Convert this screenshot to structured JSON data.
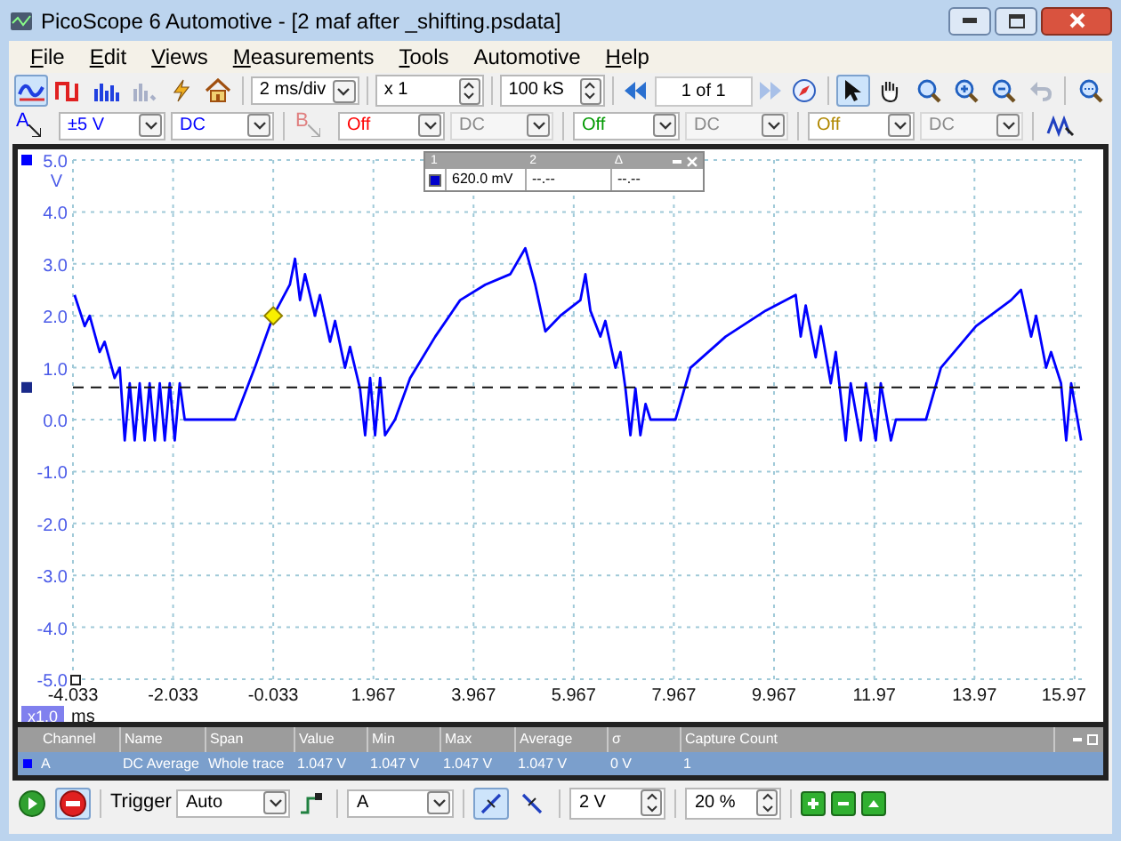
{
  "window": {
    "title": "PicoScope 6 Automotive - [2 maf after _shifting.psdata]"
  },
  "menu": [
    {
      "label": "File",
      "accelerator": true
    },
    {
      "label": "Edit",
      "accelerator": true
    },
    {
      "label": "Views",
      "accelerator": true
    },
    {
      "label": "Measurements",
      "accelerator": true
    },
    {
      "label": "Tools",
      "accelerator": true
    },
    {
      "label": "Automotive",
      "accelerator": false
    },
    {
      "label": "Help",
      "accelerator": true
    }
  ],
  "toolbar": {
    "modes": [
      {
        "kind": "scope",
        "selected": true
      },
      {
        "kind": "persistence",
        "selected": false
      },
      {
        "kind": "spectrum",
        "selected": false
      }
    ],
    "timebase": "2 ms/div",
    "zoom": "x 1",
    "samples": "100 kS",
    "buffer": "1 of 1",
    "tools": [
      {
        "kind": "pointer",
        "selected": true
      },
      {
        "kind": "hand",
        "selected": false
      },
      {
        "kind": "zoom-area",
        "selected": false
      },
      {
        "kind": "zoom-in",
        "selected": false
      },
      {
        "kind": "zoom-out",
        "selected": false
      },
      {
        "kind": "undo",
        "selected": false
      }
    ]
  },
  "channels": [
    {
      "name": "A",
      "range": "±5 V",
      "coupling": "DC",
      "color": "#0000ff",
      "enabled": true
    },
    {
      "name": "B",
      "range": "Off",
      "coupling": "DC",
      "color": "#ff0000",
      "enabled": false
    },
    {
      "range": "Off",
      "coupling": "DC",
      "color": "#009900",
      "enabled": false
    },
    {
      "range": "Off",
      "coupling": "DC",
      "color": "#b08800",
      "enabled": false
    }
  ],
  "ruler_panel": {
    "columns": [
      "1",
      "2",
      "Δ"
    ],
    "values": [
      "620.0 mV",
      "--.--",
      "--.--"
    ]
  },
  "scope": {
    "y_unit": "V",
    "x_unit": "ms",
    "x_zoom": "x1.0",
    "chart_data": {
      "type": "line",
      "xlim": [
        -4.033,
        16.15
      ],
      "ylim": [
        -5,
        5
      ],
      "grid": true,
      "ref_lines": [
        {
          "axis": "y",
          "value": 0.62
        }
      ],
      "xticks": [
        {
          "value": -4.033,
          "label": "-4.033"
        },
        {
          "value": -2.033,
          "label": "-2.033"
        },
        {
          "value": -0.033,
          "label": "-0.033"
        },
        {
          "value": 1.967,
          "label": "1.967"
        },
        {
          "value": 3.967,
          "label": "3.967"
        },
        {
          "value": 5.967,
          "label": "5.967"
        },
        {
          "value": 7.967,
          "label": "7.967"
        },
        {
          "value": 9.967,
          "label": "9.967"
        },
        {
          "value": 11.97,
          "label": "11.97"
        },
        {
          "value": 13.97,
          "label": "13.97"
        },
        {
          "value": 15.97,
          "label": "15.97"
        }
      ],
      "yticks": [
        {
          "value": 5,
          "label": "5.0"
        },
        {
          "value": 4,
          "label": "4.0"
        },
        {
          "value": 3,
          "label": "3.0"
        },
        {
          "value": 2,
          "label": "2.0"
        },
        {
          "value": 1,
          "label": "1.0"
        },
        {
          "value": 0,
          "label": "0.0"
        },
        {
          "value": -1,
          "label": "-1.0"
        },
        {
          "value": -2,
          "label": "-2.0"
        },
        {
          "value": -3,
          "label": "-3.0"
        },
        {
          "value": -4,
          "label": "-4.0"
        },
        {
          "value": -5,
          "label": "-5.0"
        }
      ],
      "x": [
        -4.0,
        -3.8,
        -3.7,
        -3.5,
        -3.4,
        -3.2,
        -3.1,
        -3.0,
        -2.9,
        -2.8,
        -2.7,
        -2.6,
        -2.5,
        -2.4,
        -2.3,
        -2.2,
        -2.1,
        -2.0,
        -1.9,
        -1.8,
        -0.8,
        -0.4,
        -0.033,
        0.3,
        0.4,
        0.5,
        0.6,
        0.8,
        0.9,
        1.1,
        1.2,
        1.4,
        1.5,
        1.7,
        1.8,
        1.9,
        2.0,
        2.1,
        2.2,
        2.4,
        2.7,
        3.2,
        3.7,
        4.2,
        4.7,
        5.0,
        5.2,
        5.4,
        5.7,
        6.1,
        6.2,
        6.3,
        6.5,
        6.6,
        6.8,
        6.9,
        7.0,
        7.1,
        7.2,
        7.3,
        7.4,
        7.5,
        8.0,
        8.3,
        9.0,
        9.8,
        10.4,
        10.5,
        10.6,
        10.8,
        10.9,
        11.1,
        11.2,
        11.4,
        11.5,
        11.7,
        11.8,
        12.0,
        12.1,
        12.3,
        12.4,
        13.0,
        13.3,
        14.0,
        14.7,
        14.9,
        15.1,
        15.2,
        15.4,
        15.5,
        15.7,
        15.8,
        15.9,
        16.1
      ],
      "series": [
        {
          "color": "#0000ff",
          "values": [
            2.4,
            1.8,
            2.0,
            1.3,
            1.5,
            0.8,
            1.0,
            -0.4,
            0.7,
            -0.4,
            0.7,
            -0.4,
            0.7,
            -0.4,
            0.7,
            -0.4,
            0.7,
            -0.4,
            0.7,
            0.0,
            0.0,
            1.0,
            2.0,
            2.6,
            3.1,
            2.3,
            2.8,
            2.0,
            2.4,
            1.5,
            1.9,
            1.0,
            1.4,
            0.6,
            -0.3,
            0.8,
            -0.3,
            0.8,
            -0.3,
            0.0,
            0.8,
            1.6,
            2.3,
            2.6,
            2.8,
            3.3,
            2.6,
            1.7,
            2.0,
            2.3,
            2.8,
            2.1,
            1.6,
            1.9,
            1.0,
            1.3,
            0.6,
            -0.3,
            0.6,
            -0.3,
            0.3,
            0.0,
            0.0,
            1.0,
            1.6,
            2.1,
            2.4,
            1.6,
            2.2,
            1.2,
            1.8,
            0.7,
            1.3,
            -0.4,
            0.7,
            -0.4,
            0.7,
            -0.4,
            0.7,
            -0.4,
            0.0,
            0.0,
            1.0,
            1.8,
            2.3,
            2.5,
            1.6,
            2.0,
            1.0,
            1.3,
            0.7,
            -0.4,
            0.7,
            -0.4
          ]
        }
      ]
    }
  },
  "measurements": {
    "columns": [
      "Channel",
      "Name",
      "Span",
      "Value",
      "Min",
      "Max",
      "Average",
      "σ",
      "Capture Count"
    ],
    "rows": [
      {
        "selected": true,
        "color": "#0000ff",
        "cells": [
          "A",
          "DC Average",
          "Whole trace",
          "1.047 V",
          "1.047 V",
          "1.047 V",
          "1.047 V",
          "0 V",
          "1"
        ]
      }
    ]
  },
  "trigger": {
    "label": "Trigger",
    "mode": "Auto",
    "source": "A",
    "edges": [
      {
        "kind": "rising",
        "selected": true
      },
      {
        "kind": "falling",
        "selected": false
      }
    ],
    "threshold": "2 V",
    "pre_trigger": "20 %"
  },
  "run_controls": [
    {
      "kind": "start",
      "selected": false
    },
    {
      "kind": "stop",
      "selected": true
    }
  ]
}
